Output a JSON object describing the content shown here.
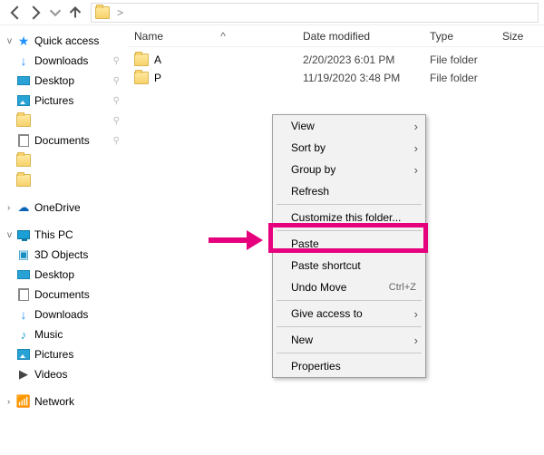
{
  "toolbar": {
    "back": "Back",
    "forward": "Forward",
    "up": "Up",
    "breadcrumb": ">"
  },
  "columns": {
    "name": "Name",
    "date": "Date modified",
    "type": "Type",
    "size": "Size",
    "sort": "^"
  },
  "files": [
    {
      "name": "A",
      "date": "2/20/2023 6:01 PM",
      "type": "File folder",
      "size": ""
    },
    {
      "name": "P",
      "date": "11/19/2020 3:48 PM",
      "type": "File folder",
      "size": ""
    }
  ],
  "sidebar": {
    "quick": "Quick access",
    "downloads": "Downloads",
    "desktop": "Desktop",
    "pictures": "Pictures",
    "blank1": "",
    "documents": "Documents",
    "blank2": "",
    "blank3": "",
    "onedrive": "OneDrive",
    "thispc": "This PC",
    "objects3d": "3D Objects",
    "desktop2": "Desktop",
    "documents2": "Documents",
    "downloads2": "Downloads",
    "music": "Music",
    "pictures2": "Pictures",
    "videos": "Videos",
    "network": "Network"
  },
  "ctx": {
    "view": "View",
    "sortby": "Sort by",
    "groupby": "Group by",
    "refresh": "Refresh",
    "customize": "Customize this folder...",
    "paste": "Paste",
    "pastesc": "Paste shortcut",
    "undo": "Undo Move",
    "undok": "Ctrl+Z",
    "giveaccess": "Give access to",
    "new": "New",
    "properties": "Properties"
  }
}
